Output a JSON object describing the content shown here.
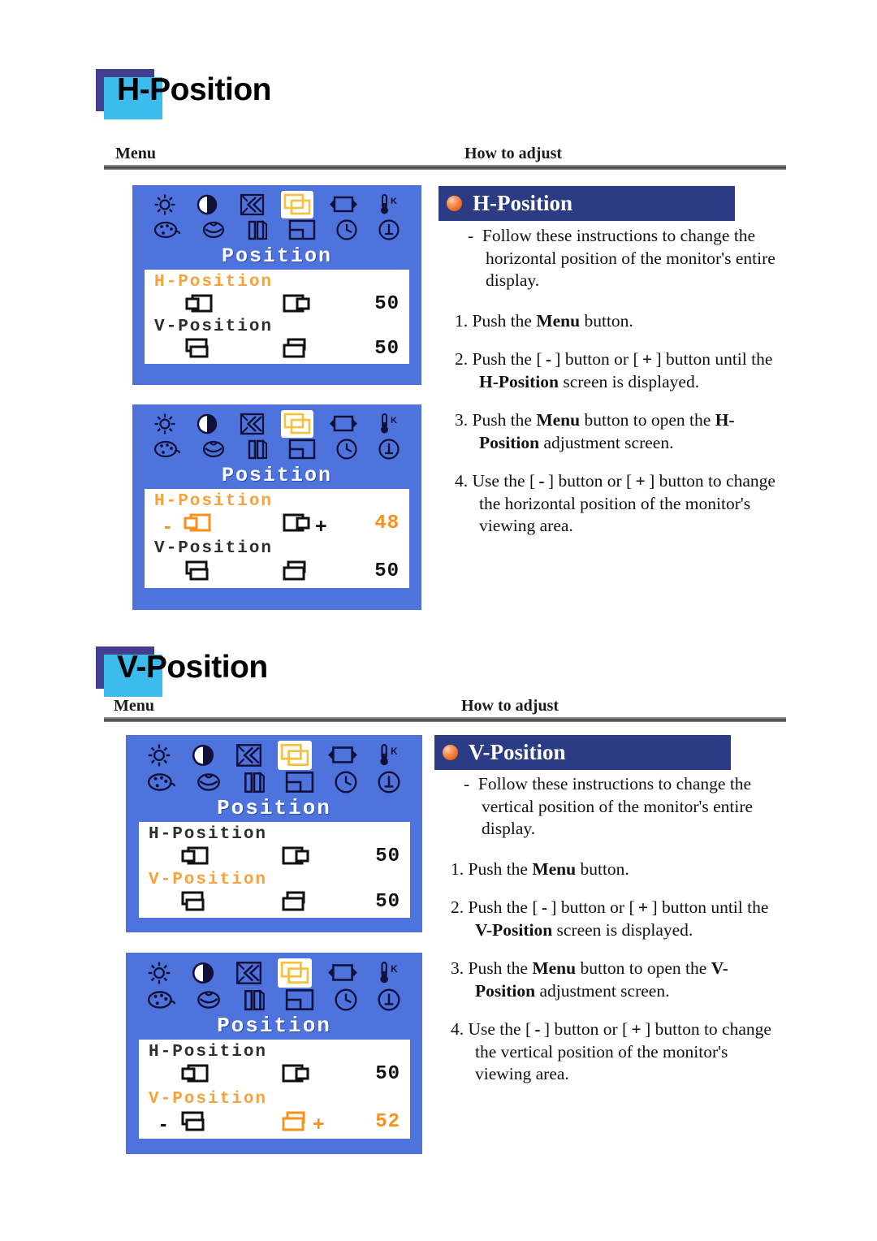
{
  "sections": [
    {
      "title": "H-Position",
      "col_menu": "Menu",
      "col_howto": "How to adjust",
      "panel_title": "H-Position",
      "intro_dash": "-",
      "intro": "Follow these instructions to change the horizontal position of the monitor's entire display.",
      "steps": [
        {
          "num": "1.",
          "text_a": "Push the ",
          "bold_a": "Menu",
          "text_b": " button."
        },
        {
          "num": "2.",
          "text_a": "Push the ",
          "key_minus": "-",
          "text_b": " button or ",
          "key_plus": "+",
          "text_c": " button until the ",
          "bold_b": "H-Position",
          "text_d": " screen is displayed."
        },
        {
          "num": "3.",
          "text_a": "Push the ",
          "bold_a": "Menu",
          "text_b": " button to open the ",
          "bold_b": "H-Position",
          "text_c": " adjustment screen."
        },
        {
          "num": "4.",
          "text_a": "Use the ",
          "key_minus": "-",
          "text_b": " button or ",
          "key_plus": "+",
          "text_c": " button to change the horizontal position of the monitor's viewing area."
        }
      ],
      "osd": [
        {
          "heading": "Position",
          "icons_row1": [
            "brightness-icon",
            "contrast-icon",
            "sharpness-icon",
            "position-icon",
            "size-icon",
            "color-temp-icon"
          ],
          "icons_row2": [
            "palette-icon",
            "osd-language-icon",
            "bars-icon",
            "osd-position-icon",
            "timer-icon",
            "information-icon"
          ],
          "selected_icon": "position-icon",
          "rows": [
            {
              "label": "H-Position",
              "label_state": "active",
              "value": "50",
              "value_state": "normal",
              "icon_left": "h-pos-left-icon",
              "icon_right": "h-pos-right-icon",
              "icon_left_state": "normal",
              "icon_right_state": "normal",
              "minus": "",
              "plus": ""
            },
            {
              "label": "V-Position",
              "label_state": "normal",
              "value": "50",
              "value_state": "normal",
              "icon_left": "v-pos-down-icon",
              "icon_right": "v-pos-up-icon",
              "icon_left_state": "normal",
              "icon_right_state": "normal",
              "minus": "",
              "plus": ""
            }
          ]
        },
        {
          "heading": "Position",
          "icons_row1": [
            "brightness-icon",
            "contrast-icon",
            "sharpness-icon",
            "position-icon",
            "size-icon",
            "color-temp-icon"
          ],
          "icons_row2": [
            "palette-icon",
            "osd-language-icon",
            "bars-icon",
            "osd-position-icon",
            "timer-icon",
            "information-icon"
          ],
          "selected_icon": "position-icon",
          "rows": [
            {
              "label": "H-Position",
              "label_state": "active",
              "value": "48",
              "value_state": "active",
              "icon_left": "h-pos-left-icon",
              "icon_right": "h-pos-right-icon",
              "icon_left_state": "active",
              "icon_right_state": "normal",
              "minus": "-",
              "plus": "+"
            },
            {
              "label": "V-Position",
              "label_state": "normal",
              "value": "50",
              "value_state": "normal",
              "icon_left": "v-pos-down-icon",
              "icon_right": "v-pos-up-icon",
              "icon_left_state": "normal",
              "icon_right_state": "normal",
              "minus": "",
              "plus": ""
            }
          ]
        }
      ]
    },
    {
      "title": "V-Position",
      "col_menu": "Menu",
      "col_howto": "How to adjust",
      "panel_title": "V-Position",
      "intro_dash": "-",
      "intro": "Follow these instructions to change the vertical position of the monitor's entire display.",
      "steps": [
        {
          "num": "1.",
          "text_a": "Push the ",
          "bold_a": "Menu",
          "text_b": " button."
        },
        {
          "num": "2.",
          "text_a": "Push the ",
          "key_minus": "-",
          "text_b": " button or ",
          "key_plus": "+",
          "text_c": " button until the ",
          "bold_b": "V-Position",
          "text_d": " screen is displayed."
        },
        {
          "num": "3.",
          "text_a": "Push the ",
          "bold_a": "Menu",
          "text_b": " button to open the ",
          "bold_b": "V-Position",
          "text_c": " adjustment screen."
        },
        {
          "num": "4.",
          "text_a": "Use the ",
          "key_minus": "-",
          "text_b": " button or ",
          "key_plus": "+",
          "text_c": " button to change the vertical position of the monitor's viewing area."
        }
      ],
      "osd": [
        {
          "heading": "Position",
          "icons_row1": [
            "brightness-icon",
            "contrast-icon",
            "sharpness-icon",
            "position-icon",
            "size-icon",
            "color-temp-icon"
          ],
          "icons_row2": [
            "palette-icon",
            "osd-language-icon",
            "bars-icon",
            "osd-position-icon",
            "timer-icon",
            "information-icon"
          ],
          "selected_icon": "position-icon",
          "rows": [
            {
              "label": "H-Position",
              "label_state": "normal",
              "value": "50",
              "value_state": "normal",
              "icon_left": "h-pos-left-icon",
              "icon_right": "h-pos-right-icon",
              "icon_left_state": "normal",
              "icon_right_state": "normal",
              "minus": "",
              "plus": ""
            },
            {
              "label": "V-Position",
              "label_state": "active",
              "value": "50",
              "value_state": "normal",
              "icon_left": "v-pos-down-icon",
              "icon_right": "v-pos-up-icon",
              "icon_left_state": "normal",
              "icon_right_state": "normal",
              "minus": "",
              "plus": ""
            }
          ]
        },
        {
          "heading": "Position",
          "icons_row1": [
            "brightness-icon",
            "contrast-icon",
            "sharpness-icon",
            "position-icon",
            "size-icon",
            "color-temp-icon"
          ],
          "icons_row2": [
            "palette-icon",
            "osd-language-icon",
            "bars-icon",
            "osd-position-icon",
            "timer-icon",
            "information-icon"
          ],
          "selected_icon": "position-icon",
          "rows": [
            {
              "label": "H-Position",
              "label_state": "normal",
              "value": "50",
              "value_state": "normal",
              "icon_left": "h-pos-left-icon",
              "icon_right": "h-pos-right-icon",
              "icon_left_state": "normal",
              "icon_right_state": "normal",
              "minus": "",
              "plus": ""
            },
            {
              "label": "V-Position",
              "label_state": "active",
              "value": "52",
              "value_state": "active",
              "icon_left": "v-pos-down-icon",
              "icon_right": "v-pos-up-icon",
              "icon_left_state": "normal",
              "icon_right_state": "active",
              "minus": "-",
              "plus": "+"
            }
          ]
        }
      ]
    }
  ],
  "colors": {
    "osd_blue": "#4E73DC",
    "osd_amber": "#F7901E",
    "header_navy": "#2B3C85",
    "title_square_back": "#423D8C",
    "title_square_front": "#3BBCEC"
  }
}
